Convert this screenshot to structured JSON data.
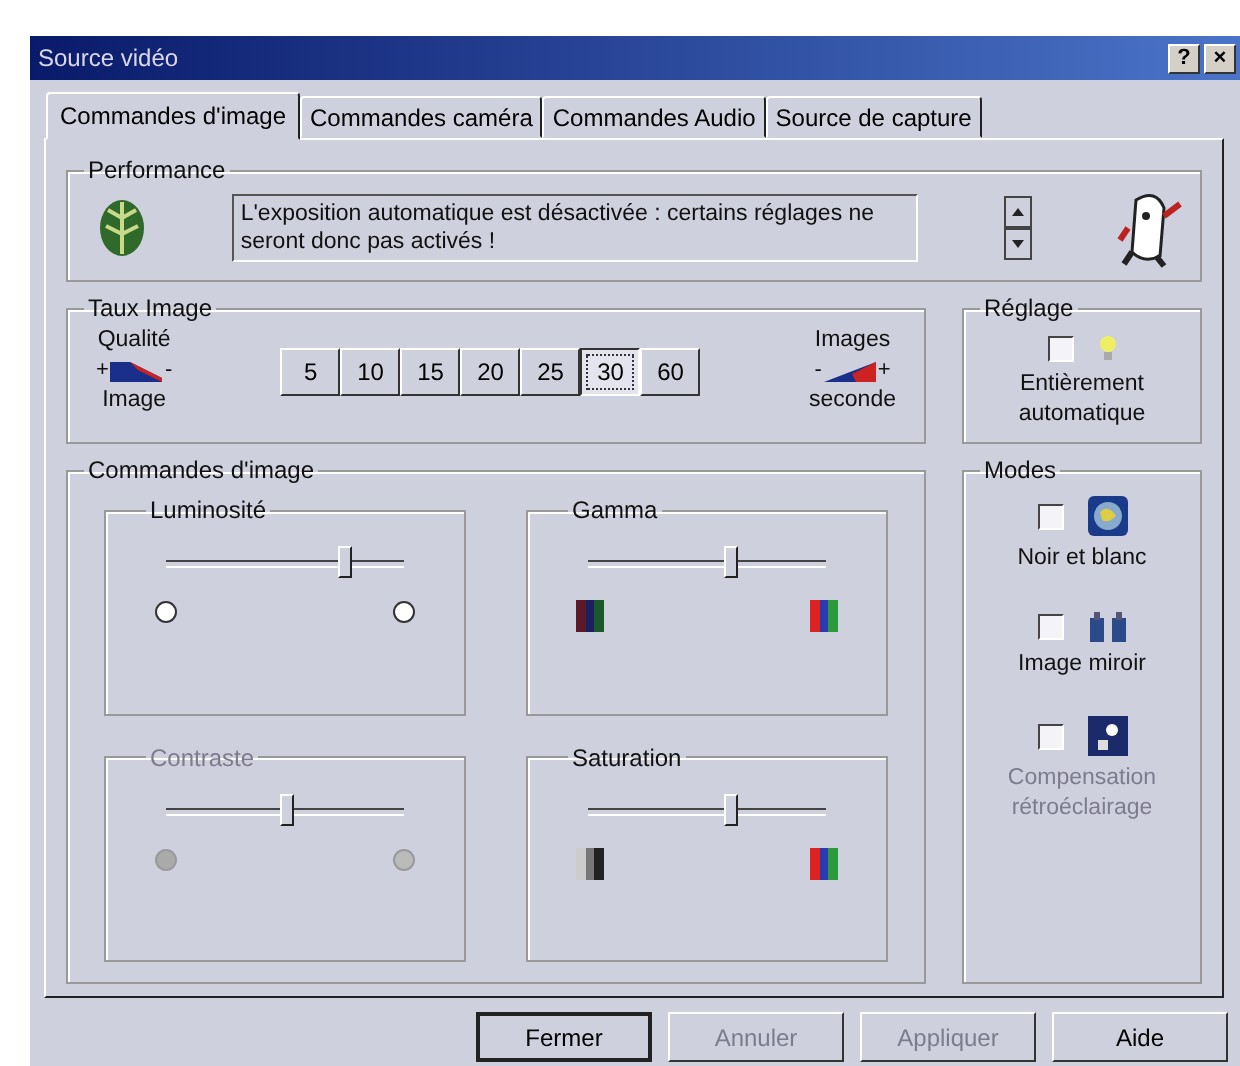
{
  "window": {
    "title": "Source vidéo",
    "help_button": "?",
    "close_button": "×"
  },
  "tabs": [
    {
      "label": "Commandes d'image",
      "selected": true
    },
    {
      "label": "Commandes caméra",
      "selected": false
    },
    {
      "label": "Commandes Audio",
      "selected": false
    },
    {
      "label": "Source de capture",
      "selected": false
    }
  ],
  "performance": {
    "title": "Performance",
    "message": "L'exposition automatique est désactivée : certains réglages ne seront donc pas activés !"
  },
  "frame_rate": {
    "title": "Taux Image",
    "left_top": "Qualité",
    "left_plus": "+",
    "left_minus": "-",
    "left_bottom": "Image",
    "right_top": "Images",
    "right_minus": "-",
    "right_plus": "+",
    "right_bottom": "seconde",
    "rates": [
      {
        "label": "5",
        "selected": false
      },
      {
        "label": "10",
        "selected": false
      },
      {
        "label": "15",
        "selected": false
      },
      {
        "label": "20",
        "selected": false
      },
      {
        "label": "25",
        "selected": false
      },
      {
        "label": "30",
        "selected": true
      },
      {
        "label": "60",
        "selected": false
      }
    ]
  },
  "setting": {
    "title": "Réglage",
    "label": "Entièrement automatique",
    "checked": false
  },
  "image_controls": {
    "title": "Commandes d'image",
    "groups": [
      {
        "title": "Luminosité",
        "kind": "circles",
        "level": 0.75,
        "disabled": false
      },
      {
        "title": "Gamma",
        "kind": "colors",
        "level": 0.6,
        "disabled": false
      },
      {
        "title": "Contraste",
        "kind": "circles",
        "level": 0.5,
        "disabled": true
      },
      {
        "title": "Saturation",
        "kind": "saturation",
        "level": 0.6,
        "disabled": false
      }
    ]
  },
  "modes": {
    "title": "Modes",
    "items": [
      {
        "kind": "globe",
        "label": "Noir et blanc",
        "checked": false,
        "disabled": false
      },
      {
        "kind": "mirror",
        "label": "Image miroir",
        "checked": false,
        "disabled": false
      },
      {
        "kind": "backlight",
        "label": "Compensation rétroéclairage",
        "checked": false,
        "disabled": true
      }
    ]
  },
  "buttons": [
    {
      "label": "Fermer",
      "disabled": false,
      "default": true
    },
    {
      "label": "Annuler",
      "disabled": true,
      "default": false
    },
    {
      "label": "Appliquer",
      "disabled": true,
      "default": false
    },
    {
      "label": "Aide",
      "disabled": false,
      "default": false
    }
  ]
}
